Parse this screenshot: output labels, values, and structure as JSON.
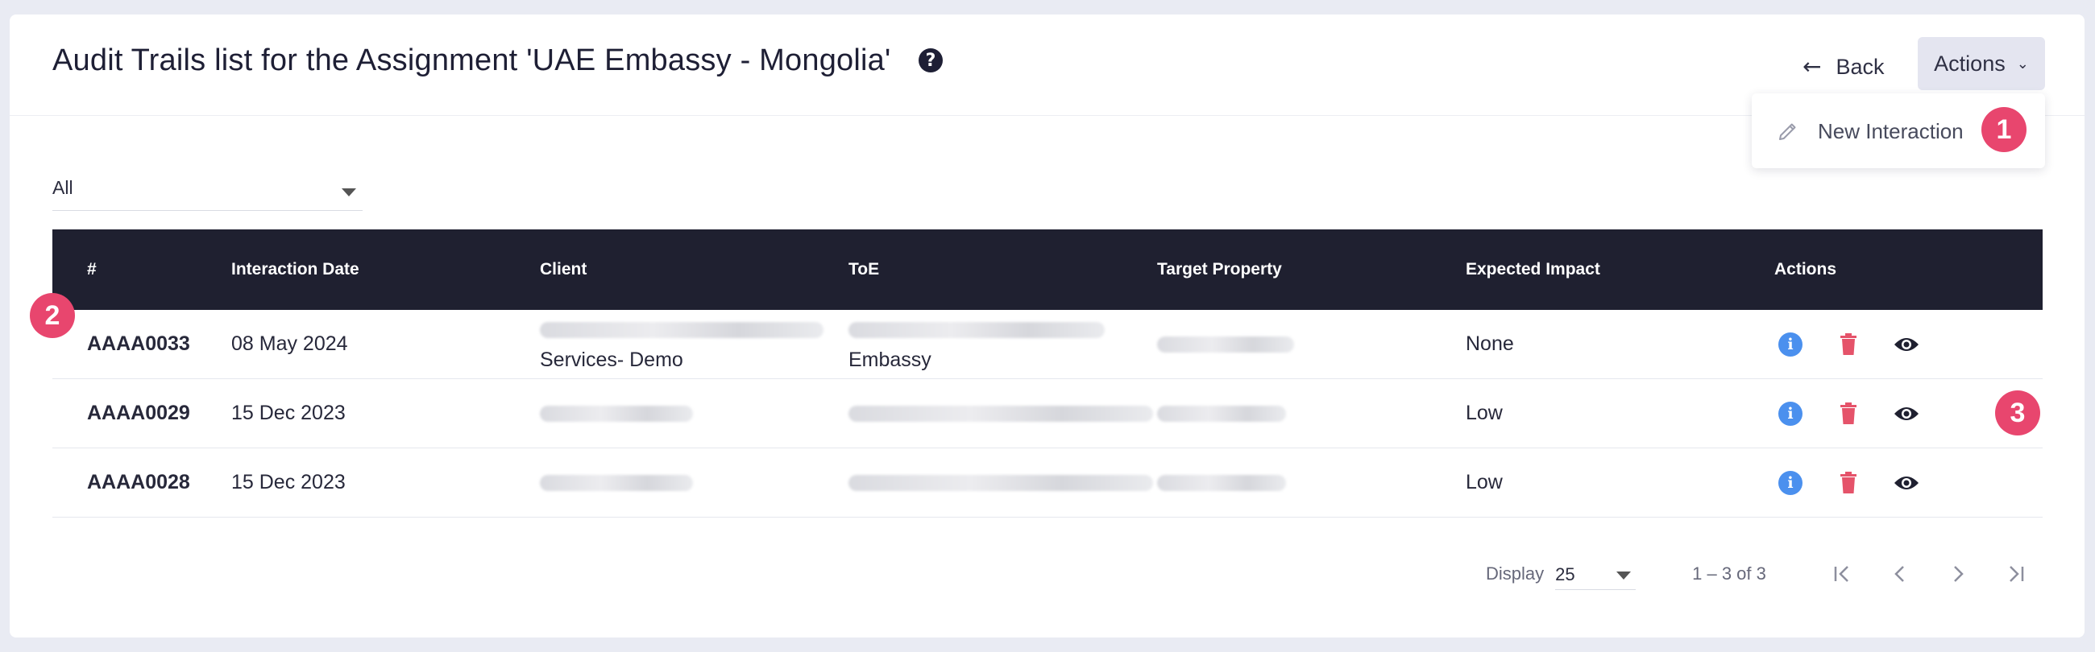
{
  "header": {
    "title": "Audit Trails list for the Assignment 'UAE Embassy - Mongolia'",
    "help_icon": "question-circle-icon",
    "back_label": "Back",
    "actions_label": "Actions"
  },
  "actions_menu": {
    "items": [
      {
        "label": "New Interaction",
        "icon": "pencil-icon"
      }
    ]
  },
  "markers": [
    "1",
    "2",
    "3"
  ],
  "filter": {
    "selected": "All"
  },
  "table": {
    "columns": [
      "#",
      "Interaction Date",
      "Client",
      "ToE",
      "Target Property",
      "Expected Impact",
      "Actions"
    ],
    "rows": [
      {
        "id": "AAAA0033",
        "date": "08 May 2024",
        "client_line2": "Services- Demo",
        "toe_line2": "Embassy",
        "impact": "None"
      },
      {
        "id": "AAAA0029",
        "date": "15 Dec 2023",
        "impact": "Low"
      },
      {
        "id": "AAAA0028",
        "date": "15 Dec 2023",
        "impact": "Low"
      }
    ]
  },
  "row_actions": [
    "info-icon",
    "trash-icon",
    "eye-icon"
  ],
  "pagination": {
    "display_label": "Display",
    "page_size": "25",
    "range": "1 – 3 of 3"
  },
  "colors": {
    "header_bg": "#1f2030",
    "marker": "#e8466e",
    "info": "#4b90ee",
    "delete": "#e5536a",
    "page_bg": "#e9ebf3"
  }
}
